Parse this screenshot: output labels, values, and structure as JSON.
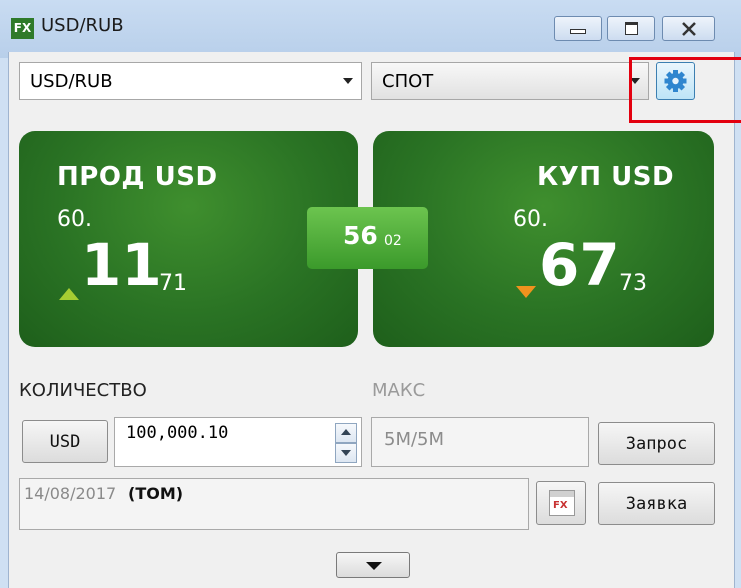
{
  "window": {
    "title": "USD/RUB",
    "logo": "FX"
  },
  "pair": {
    "value": "USD/RUB"
  },
  "tenor": {
    "value": "СПОТ"
  },
  "sell": {
    "label": "ПРОД USD",
    "prefix": "60.",
    "big": "11",
    "pips": "71",
    "arrow": "up",
    "arrow_color": "#a6cd32"
  },
  "buy": {
    "label": "КУП USD",
    "prefix": "60.",
    "big": "67",
    "pips": "73",
    "arrow": "down",
    "arrow_color": "#f0921e"
  },
  "spread": {
    "big": "56",
    "small": "02"
  },
  "quantity": {
    "label": "КОЛИЧЕСТВО",
    "currency": "USD",
    "value": "100,000.10"
  },
  "max": {
    "label": "МАКС",
    "value": "5M/5M"
  },
  "date": {
    "value": "14/08/2017",
    "tenor": "(TOM)"
  },
  "buttons": {
    "request": "Запрос",
    "order": "Заявка"
  },
  "colors": {
    "tile_green": "#2a7324",
    "spread_green": "#4fae36",
    "highlight_red": "#e3000f",
    "accent_blue": "#3c7fb1"
  }
}
